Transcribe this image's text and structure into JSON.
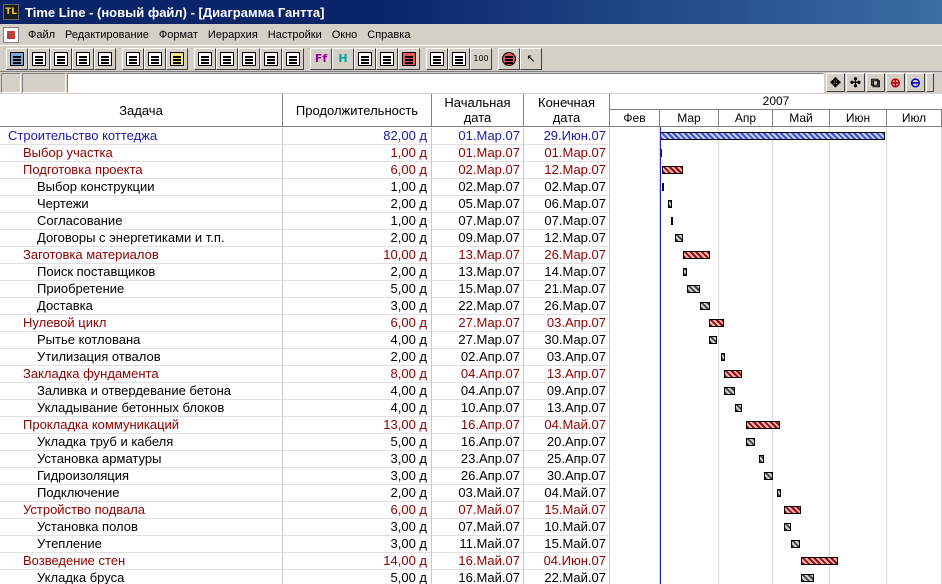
{
  "window": {
    "icon_text": "TL",
    "title": "Time Line - (новый файл) - [Диаграмма Гантта]"
  },
  "menu": [
    "Файл",
    "Редактирование",
    "Формат",
    "Иерархия",
    "Настройки",
    "Окно",
    "Справка"
  ],
  "toolbar": {
    "ff_label": "Ff",
    "h_label": "H",
    "pct_label": "100"
  },
  "columns": {
    "task": "Задача",
    "duration": "Продолжительность",
    "start": "Начальная дата",
    "end": "Конечная дата"
  },
  "timeline": {
    "year": "2007",
    "months": [
      "Фев",
      "Мар",
      "Апр",
      "Май",
      "Июн",
      "Июл"
    ]
  },
  "colors": {
    "project": "#1a1aa0",
    "summary": "#8b0000",
    "task": "#000000"
  },
  "tasks": [
    {
      "name": "Строительство коттеджа",
      "duration": "82,00 д",
      "start": "01.Мар.07",
      "end": "29.Июн.07",
      "level": 0
    },
    {
      "name": "Выбор участка",
      "duration": "1,00 д",
      "start": "01.Мар.07",
      "end": "01.Мар.07",
      "level": 1
    },
    {
      "name": "Подготовка проекта",
      "duration": "6,00 д",
      "start": "02.Мар.07",
      "end": "12.Мар.07",
      "level": 1
    },
    {
      "name": "Выбор конструкции",
      "duration": "1,00 д",
      "start": "02.Мар.07",
      "end": "02.Мар.07",
      "level": 2
    },
    {
      "name": "Чертежи",
      "duration": "2,00 д",
      "start": "05.Мар.07",
      "end": "06.Мар.07",
      "level": 2
    },
    {
      "name": "Согласование",
      "duration": "1,00 д",
      "start": "07.Мар.07",
      "end": "07.Мар.07",
      "level": 2
    },
    {
      "name": "Договоры с энергетиками и т.п.",
      "duration": "2,00 д",
      "start": "09.Мар.07",
      "end": "12.Мар.07",
      "level": 2
    },
    {
      "name": "Заготовка материалов",
      "duration": "10,00 д",
      "start": "13.Мар.07",
      "end": "26.Мар.07",
      "level": 1
    },
    {
      "name": "Поиск поставщиков",
      "duration": "2,00 д",
      "start": "13.Мар.07",
      "end": "14.Мар.07",
      "level": 2
    },
    {
      "name": "Приобретение",
      "duration": "5,00 д",
      "start": "15.Мар.07",
      "end": "21.Мар.07",
      "level": 2
    },
    {
      "name": "Доставка",
      "duration": "3,00 д",
      "start": "22.Мар.07",
      "end": "26.Мар.07",
      "level": 2
    },
    {
      "name": "Нулевой цикл",
      "duration": "6,00 д",
      "start": "27.Мар.07",
      "end": "03.Апр.07",
      "level": 1
    },
    {
      "name": "Рытье котлована",
      "duration": "4,00 д",
      "start": "27.Мар.07",
      "end": "30.Мар.07",
      "level": 2
    },
    {
      "name": "Утилизация отвалов",
      "duration": "2,00 д",
      "start": "02.Апр.07",
      "end": "03.Апр.07",
      "level": 2
    },
    {
      "name": "Закладка фундамента",
      "duration": "8,00 д",
      "start": "04.Апр.07",
      "end": "13.Апр.07",
      "level": 1
    },
    {
      "name": "Заливка и отвердевание бетона",
      "duration": "4,00 д",
      "start": "04.Апр.07",
      "end": "09.Апр.07",
      "level": 2
    },
    {
      "name": "Укладывание бетонных блоков",
      "duration": "4,00 д",
      "start": "10.Апр.07",
      "end": "13.Апр.07",
      "level": 2
    },
    {
      "name": "Прокладка коммуникаций",
      "duration": "13,00 д",
      "start": "16.Апр.07",
      "end": "04.Май.07",
      "level": 1
    },
    {
      "name": "Укладка труб и кабеля",
      "duration": "5,00 д",
      "start": "16.Апр.07",
      "end": "20.Апр.07",
      "level": 2
    },
    {
      "name": "Установка арматуры",
      "duration": "3,00 д",
      "start": "23.Апр.07",
      "end": "25.Апр.07",
      "level": 2
    },
    {
      "name": "Гидроизоляция",
      "duration": "3,00 д",
      "start": "26.Апр.07",
      "end": "30.Апр.07",
      "level": 2
    },
    {
      "name": "Подключение",
      "duration": "2,00 д",
      "start": "03.Май.07",
      "end": "04.Май.07",
      "level": 2
    },
    {
      "name": "Устройство подвала",
      "duration": "6,00 д",
      "start": "07.Май.07",
      "end": "15.Май.07",
      "level": 1
    },
    {
      "name": "Установка полов",
      "duration": "3,00 д",
      "start": "07.Май.07",
      "end": "10.Май.07",
      "level": 2
    },
    {
      "name": "Утепление",
      "duration": "3,00 д",
      "start": "11.Май.07",
      "end": "15.Май.07",
      "level": 2
    },
    {
      "name": "Возведение стен",
      "duration": "14,00 д",
      "start": "16.Май.07",
      "end": "04.Июн.07",
      "level": 1
    },
    {
      "name": "Укладка бруса",
      "duration": "5,00 д",
      "start": "16.Май.07",
      "end": "22.Май.07",
      "level": 2
    }
  ]
}
